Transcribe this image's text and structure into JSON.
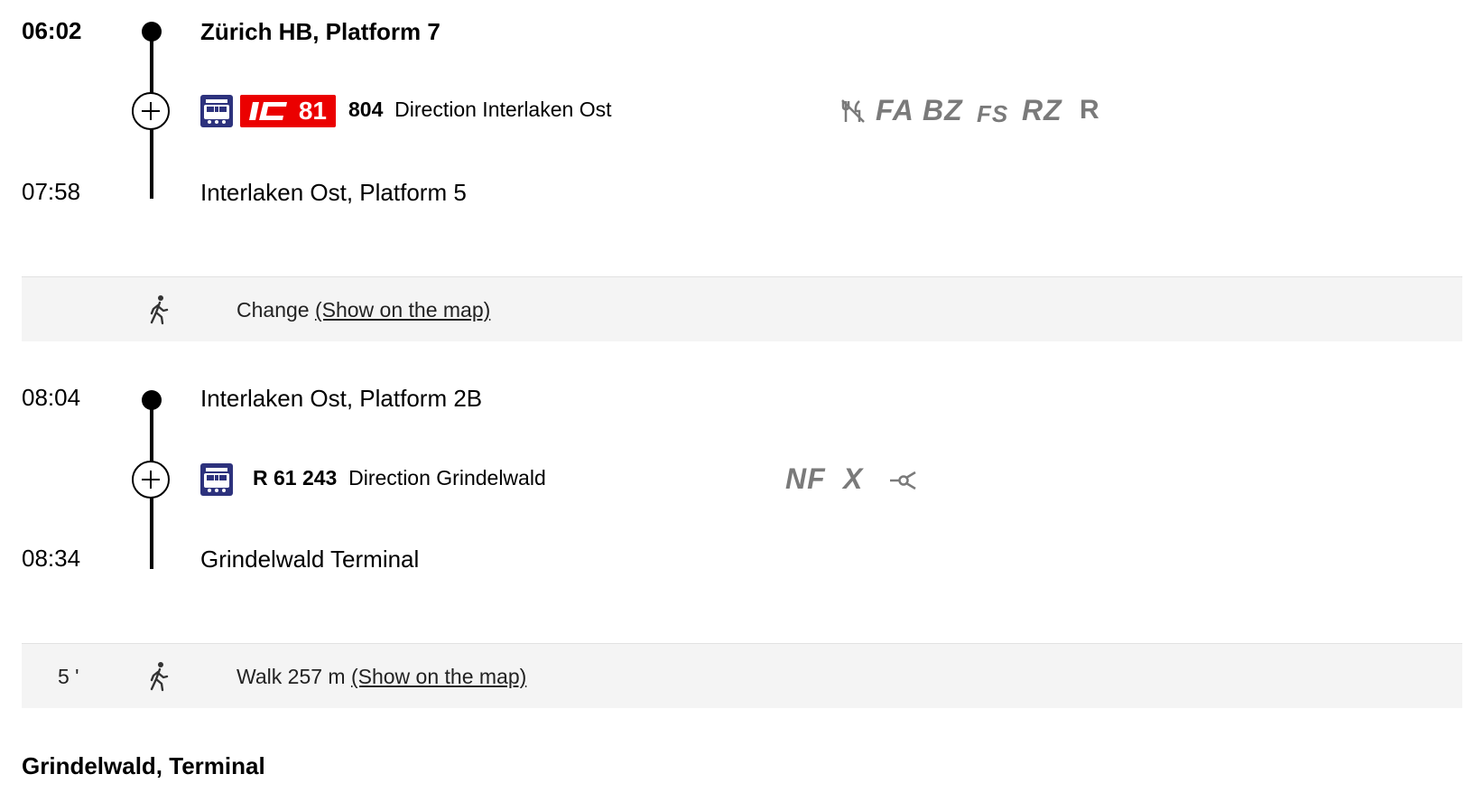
{
  "leg1": {
    "dep_time": "06:02",
    "dep_station": "Zürich HB, Platform 7",
    "product_badge": "IC",
    "line_number": "81",
    "train_number": "804",
    "direction": "Direction Interlaken Ost",
    "attributes": [
      "FA",
      "BZ",
      "FS",
      "RZ",
      "R"
    ],
    "arr_time": "07:58",
    "arr_station": "Interlaken Ost, Platform 5"
  },
  "change1": {
    "label": "Change",
    "map_link": "(Show on the map)"
  },
  "leg2": {
    "dep_time": "08:04",
    "dep_station": "Interlaken Ost, Platform 2B",
    "train_label": "R 61 243",
    "direction": "Direction Grindelwald",
    "attributes": [
      "NF",
      "X"
    ],
    "arr_time": "08:34",
    "arr_station": "Grindelwald Terminal"
  },
  "walk": {
    "duration": "5 '",
    "label": "Walk 257 m",
    "map_link": "(Show on the map)"
  },
  "destination": "Grindelwald, Terminal",
  "colors": {
    "ic_red": "#eb0000",
    "train_blue": "#2d327d",
    "attr_gray": "#7a7a7a",
    "band_bg": "#f4f4f4"
  },
  "icons": {
    "train": "train-icon",
    "walk": "walking-person-icon",
    "expand": "plus-circle-icon",
    "restaurant": "no-restaurant-icon",
    "coupling": "coupling-icon"
  }
}
